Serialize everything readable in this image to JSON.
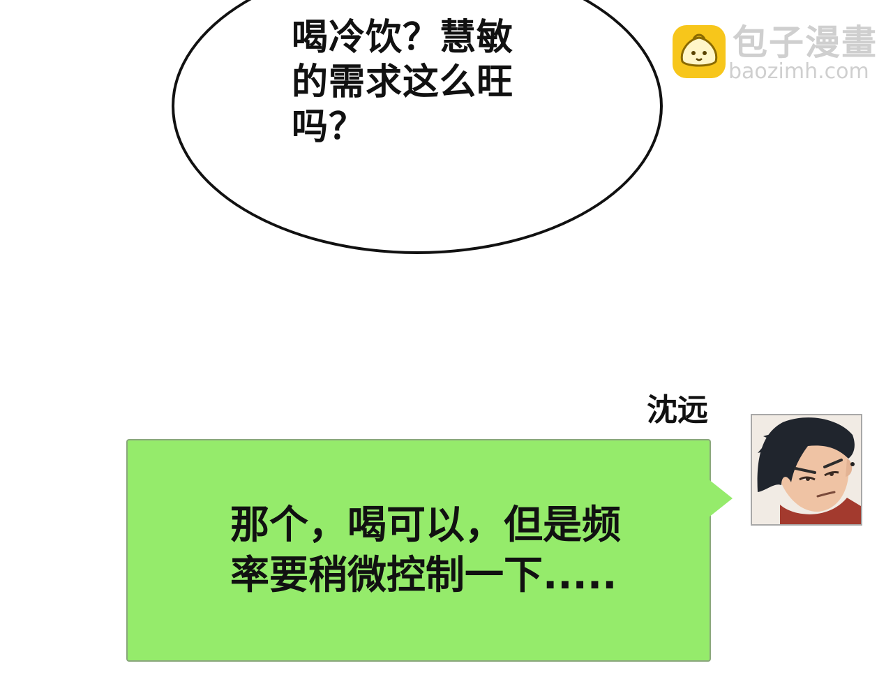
{
  "speech_bubble": {
    "lines": [
      "喝冷饮？慧敏",
      "的需求这么旺",
      "吗？"
    ]
  },
  "watermark": {
    "name": "包子漫畫",
    "url": "baozimh.com",
    "icon": "bun-logo-icon",
    "color": "#f7c61b"
  },
  "chat": {
    "sender": "沈远",
    "avatar": "character-portrait",
    "bubble_color": "#95eb6b",
    "lines": [
      "那个，喝可以，但是频",
      "率要稍微控制一下....."
    ]
  }
}
